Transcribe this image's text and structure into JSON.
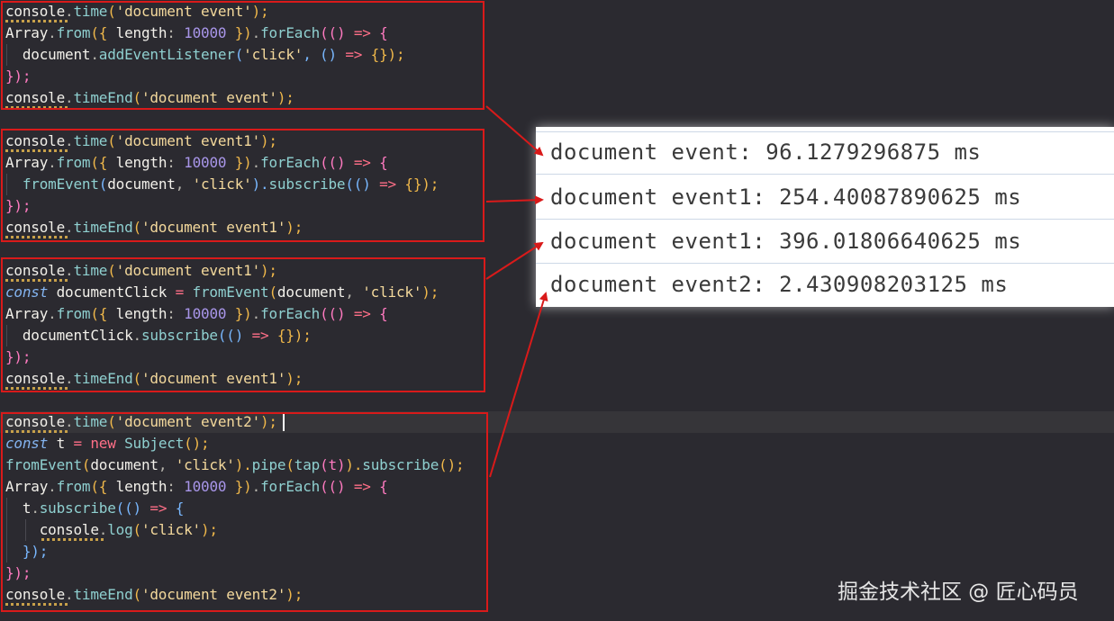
{
  "editor": {
    "block1": {
      "l1": {
        "a": "console",
        "b": ".",
        "c": "time",
        "d": "(",
        "e": "'document event'",
        "f": ");"
      },
      "l2": {
        "a": "Array",
        "b": ".",
        "c": "from",
        "d": "({ ",
        "e": "length",
        "f": ": ",
        "g": "10000",
        "h": " })",
        "i": ".",
        "j": "forEach",
        "k": "(() ",
        "l": "=>",
        "m": " {"
      },
      "l3": {
        "a": "document",
        "b": ".",
        "c": "addEventListener",
        "d": "(",
        "e": "'click'",
        "f": ", () ",
        "g": "=>",
        "h": " {});"
      },
      "l4": {
        "a": "});"
      },
      "l5": {
        "a": "console",
        "b": ".",
        "c": "timeEnd",
        "d": "(",
        "e": "'document event'",
        "f": ");"
      }
    },
    "block2": {
      "l1": {
        "a": "console",
        "b": ".",
        "c": "time",
        "d": "(",
        "e": "'document event1'",
        "f": ");"
      },
      "l2": {
        "a": "Array",
        "b": ".",
        "c": "from",
        "d": "({ ",
        "e": "length",
        "f": ": ",
        "g": "10000",
        "h": " })",
        "i": ".",
        "j": "forEach",
        "k": "(() ",
        "l": "=>",
        "m": " {"
      },
      "l3": {
        "a": "fromEvent",
        "b": "(",
        "c": "document",
        "d": ", ",
        "e": "'click'",
        "f": ").",
        "g": "subscribe",
        "h": "(() ",
        "i": "=>",
        "j": " {});"
      },
      "l4": {
        "a": "});"
      },
      "l5": {
        "a": "console",
        "b": ".",
        "c": "timeEnd",
        "d": "(",
        "e": "'document event1'",
        "f": ");"
      }
    },
    "block3": {
      "l1": {
        "a": "console",
        "b": ".",
        "c": "time",
        "d": "(",
        "e": "'document event1'",
        "f": ");"
      },
      "l2": {
        "a": "const",
        "b": " documentClick ",
        "c": "=",
        "d": " ",
        "e": "fromEvent",
        "f": "(",
        "g": "document",
        "h": ", ",
        "i": "'click'",
        "j": ");"
      },
      "l3": {
        "a": "Array",
        "b": ".",
        "c": "from",
        "d": "({ ",
        "e": "length",
        "f": ": ",
        "g": "10000",
        "h": " })",
        "i": ".",
        "j": "forEach",
        "k": "(() ",
        "l": "=>",
        "m": " {"
      },
      "l4": {
        "a": "documentClick",
        "b": ".",
        "c": "subscribe",
        "d": "(() ",
        "e": "=>",
        "f": " {});"
      },
      "l5": {
        "a": "});"
      },
      "l6": {
        "a": "console",
        "b": ".",
        "c": "timeEnd",
        "d": "(",
        "e": "'document event1'",
        "f": ");"
      }
    },
    "block4": {
      "l1": {
        "a": "console",
        "b": ".",
        "c": "time",
        "d": "(",
        "e": "'document event2'",
        "f": ");"
      },
      "l2": {
        "a": "const",
        "b": " t ",
        "c": "=",
        "d": " ",
        "e": "new",
        "f": " Subject",
        "g": "();"
      },
      "l3": {
        "a": "fromEvent",
        "b": "(",
        "c": "document",
        "d": ", ",
        "e": "'click'",
        "f": ").",
        "g": "pipe",
        "h": "(",
        "i": "tap",
        "j": "(t)",
        "k": ").",
        "l": "subscribe",
        "m": "();"
      },
      "l4": {
        "a": "Array",
        "b": ".",
        "c": "from",
        "d": "({ ",
        "e": "length",
        "f": ": ",
        "g": "10000",
        "h": " })",
        "i": ".",
        "j": "forEach",
        "k": "(() ",
        "l": "=>",
        "m": " {"
      },
      "l5": {
        "a": "t",
        "b": ".",
        "c": "subscribe",
        "d": "(() ",
        "e": "=>",
        "f": " {"
      },
      "l6": {
        "a": "console",
        "b": ".",
        "c": "log",
        "d": "(",
        "e": "'click'",
        "f": ");"
      },
      "l7": {
        "a": "});"
      },
      "l8": {
        "a": "});"
      },
      "l9": {
        "a": "console",
        "b": ".",
        "c": "timeEnd",
        "d": "(",
        "e": "'document event2'",
        "f": ");"
      }
    }
  },
  "console_output": [
    "document event: 96.1279296875 ms",
    "document event1: 254.40087890625 ms",
    "document event1: 396.01806640625 ms",
    "document event2: 2.430908203125 ms"
  ],
  "watermark": "掘金技术社区 @ 匠心码员",
  "colors": {
    "frame": "#d91a1a",
    "editor_bg": "#2b2a30",
    "output_bg": "#ffffff"
  }
}
